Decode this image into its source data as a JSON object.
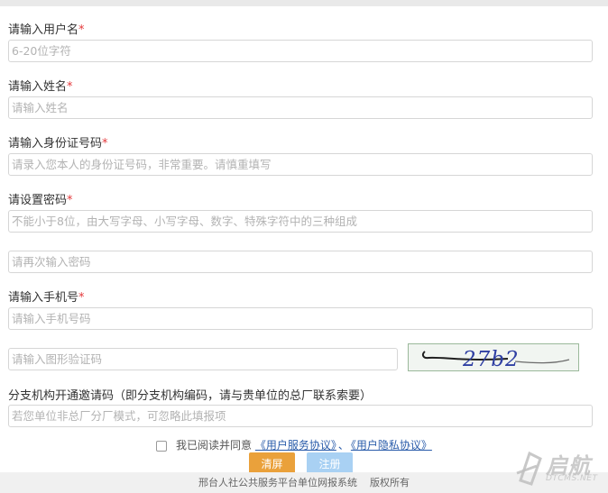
{
  "form": {
    "username": {
      "label": "请输入用户名",
      "required_mark": "*",
      "placeholder": "6-20位字符"
    },
    "realname": {
      "label": "请输入姓名",
      "required_mark": "*",
      "placeholder": "请输入姓名"
    },
    "idcard": {
      "label": "请输入身份证号码",
      "required_mark": "*",
      "placeholder": "请录入您本人的身份证号码，非常重要。请慎重填写"
    },
    "password": {
      "label": "请设置密码",
      "required_mark": "*",
      "placeholder": "不能小于8位，由大写字母、小写字母、数字、特殊字符中的三种组成"
    },
    "password_confirm": {
      "placeholder": "请再次输入密码"
    },
    "phone": {
      "label": "请输入手机号",
      "required_mark": "*",
      "placeholder": "请输入手机号码"
    },
    "captcha": {
      "placeholder": "请输入图形验证码",
      "code": "27b2"
    },
    "invite": {
      "label": "分支机构开通邀请码（即分支机构编码，请与贵单位的总厂联系索要）",
      "placeholder": "若您单位非总厂分厂模式，可忽略此填报项"
    }
  },
  "agreement": {
    "text": "我已阅读并同意",
    "service_link": "《用户服务协议》",
    "separator": "、",
    "privacy_link": "《用户隐私协议》"
  },
  "buttons": {
    "reset": "清屏",
    "register": "注册"
  },
  "footer": {
    "text": "邢台人社公共服务平台单位网报系统    版权所有"
  },
  "watermark": {
    "main": "启航",
    "sub": "DTCMS.NET"
  },
  "colors": {
    "required": "#e4393c",
    "reset_button": "#eaa13b",
    "register_button": "#a9d1f3",
    "link": "#2a5caa"
  }
}
